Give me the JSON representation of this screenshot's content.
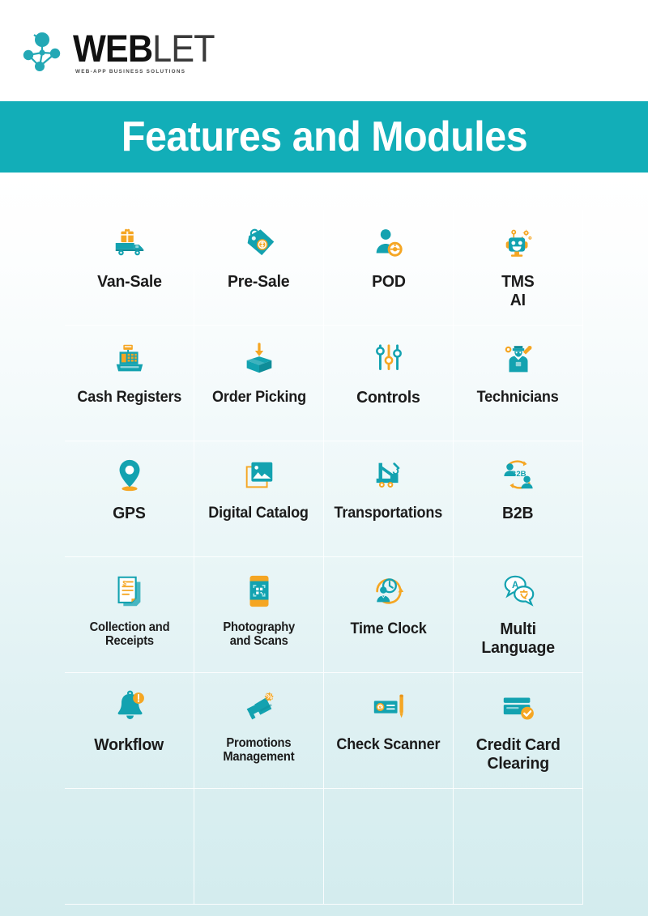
{
  "brand": {
    "logo_mark": "network-nodes-logo",
    "name_bold": "WEB",
    "name_light": "LET",
    "tagline": "WEB-APP BUSINESS SOLUTIONS"
  },
  "banner": {
    "title": "Features and Modules",
    "background_color": "#12aeb8",
    "text_color": "#ffffff"
  },
  "theme": {
    "teal": "#13a2b0",
    "teal_dark": "#0f8d99",
    "orange": "#f5a623",
    "orange_dark": "#e8941a",
    "label_color": "#1b1b1b",
    "bg_top": "#ffffff",
    "bg_bottom": "#d3ecee"
  },
  "grid": {
    "columns": 4,
    "rows_visible": 5,
    "items": [
      {
        "label": "Van-Sale",
        "icon": "delivery-truck-icon",
        "size": "lg"
      },
      {
        "label": "Pre-Sale",
        "icon": "price-tag-icon",
        "size": "lg"
      },
      {
        "label": "POD",
        "icon": "driver-person-icon",
        "size": "lg"
      },
      {
        "label": "TMS\nAI",
        "icon": "robot-icon",
        "size": "lg"
      },
      {
        "label": "Cash Registers",
        "icon": "cash-register-icon",
        "size": "md"
      },
      {
        "label": "Order Picking",
        "icon": "box-arrow-icon",
        "size": "md"
      },
      {
        "label": "Controls",
        "icon": "sliders-icon",
        "size": "lg"
      },
      {
        "label": "Technicians",
        "icon": "technician-worker-icon",
        "size": "md"
      },
      {
        "label": "GPS",
        "icon": "map-pin-icon",
        "size": "lg"
      },
      {
        "label": "Digital Catalog",
        "icon": "image-gallery-icon",
        "size": "md"
      },
      {
        "label": "Transportations",
        "icon": "crane-truck-icon",
        "size": "md"
      },
      {
        "label": "B2B",
        "icon": "b2b-people-icon",
        "size": "lg"
      },
      {
        "label": "Collection and\nReceipts",
        "icon": "receipts-stack-icon",
        "size": "sm"
      },
      {
        "label": "Photography\nand Scans",
        "icon": "phone-qr-scan-icon",
        "size": "sm"
      },
      {
        "label": "Time Clock",
        "icon": "time-clock-person-icon",
        "size": "md"
      },
      {
        "label": "Multi\nLanguage",
        "icon": "translate-bubbles-icon",
        "size": "lg"
      },
      {
        "label": "Workflow",
        "icon": "bell-alert-icon",
        "size": "lg"
      },
      {
        "label": "Promotions\nManagement",
        "icon": "megaphone-discount-icon",
        "size": "sm"
      },
      {
        "label": "Check Scanner",
        "icon": "cheque-pen-icon",
        "size": "md"
      },
      {
        "label": "Credit Card\nClearing",
        "icon": "credit-card-check-icon",
        "size": "lg"
      }
    ]
  }
}
